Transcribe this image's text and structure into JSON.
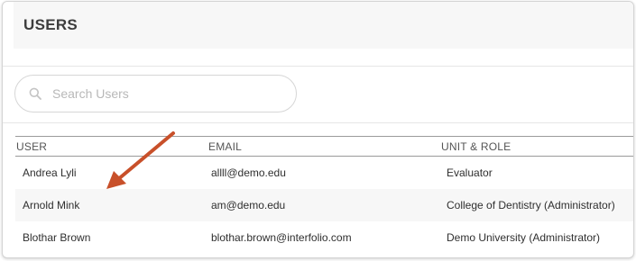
{
  "page": {
    "title": "USERS"
  },
  "search": {
    "placeholder": "Search Users",
    "value": ""
  },
  "table": {
    "headers": {
      "user": "USER",
      "email": "EMAIL",
      "unit_role": "UNIT & ROLE"
    },
    "rows": [
      {
        "user": "Andrea Lyli",
        "email": "allll@demo.edu",
        "unit_role": "Evaluator"
      },
      {
        "user": "Arnold Mink",
        "email": "am@demo.edu",
        "unit_role": "College of Dentistry (Administrator)"
      },
      {
        "user": "Blothar Brown",
        "email": "blothar.brown@interfolio.com",
        "unit_role": "Demo University (Administrator)"
      }
    ]
  },
  "annotation": {
    "arrow_color": "#c8502a"
  }
}
